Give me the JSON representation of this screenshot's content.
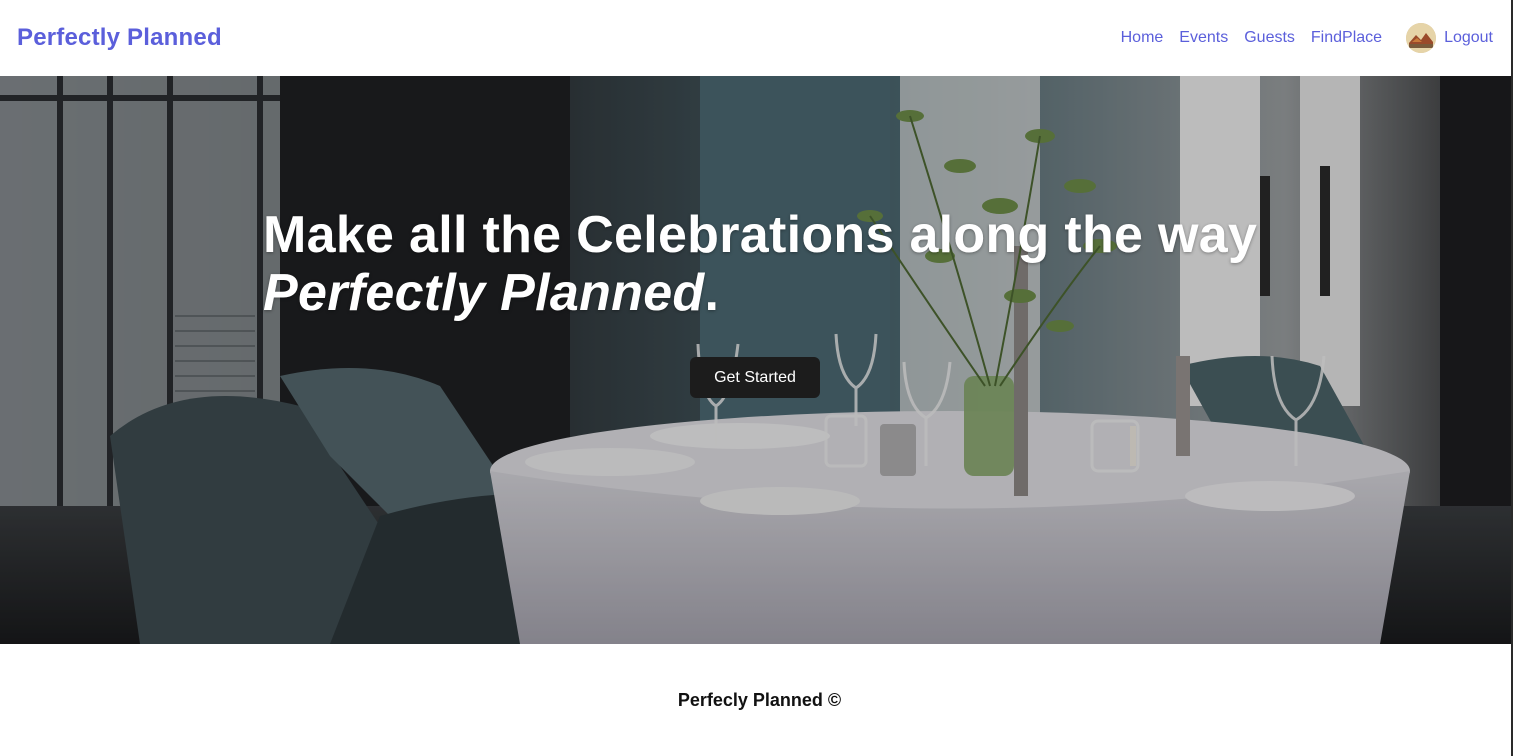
{
  "header": {
    "brand": "Perfectly Planned",
    "nav": [
      {
        "label": "Home"
      },
      {
        "label": "Events"
      },
      {
        "label": "Guests"
      },
      {
        "label": "FindPlace"
      }
    ],
    "avatar_icon": "user-avatar-icon",
    "logout_label": "Logout"
  },
  "hero": {
    "headline_line1": "Make all the Celebrations along the way",
    "headline_line2": "Perfectly Planned",
    "headline_line2_end": ".",
    "cta_label": "Get Started",
    "background": "restaurant table setting photo"
  },
  "footer": {
    "text": "Perfecly Planned ©"
  },
  "colors": {
    "brand": "#5b5fdb",
    "nav": "#5b5fdb",
    "button_bg": "#1c1c1c",
    "hero_text": "#ffffff"
  }
}
